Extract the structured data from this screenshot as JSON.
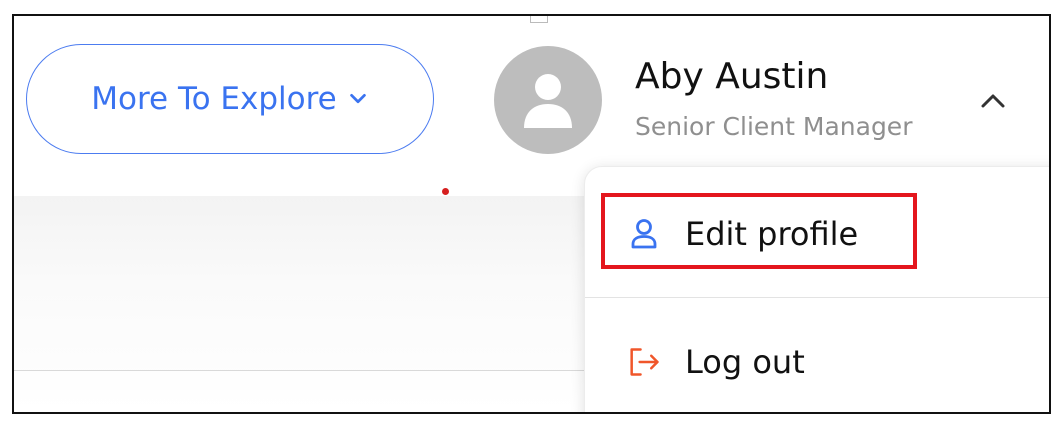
{
  "nav": {
    "explore_label": "More To Explore"
  },
  "user": {
    "name": "Aby Austin",
    "role": "Senior Client Manager"
  },
  "menu": {
    "items": [
      {
        "label": "Edit profile",
        "icon": "user-icon",
        "color": "#3a73f0"
      },
      {
        "label": "Log out",
        "icon": "logout-icon",
        "color": "#f0562a"
      }
    ]
  },
  "colors": {
    "accent": "#3a73f0",
    "highlight": "#e4161d",
    "logout": "#f0562a",
    "avatar_bg": "#bdbdbd"
  }
}
